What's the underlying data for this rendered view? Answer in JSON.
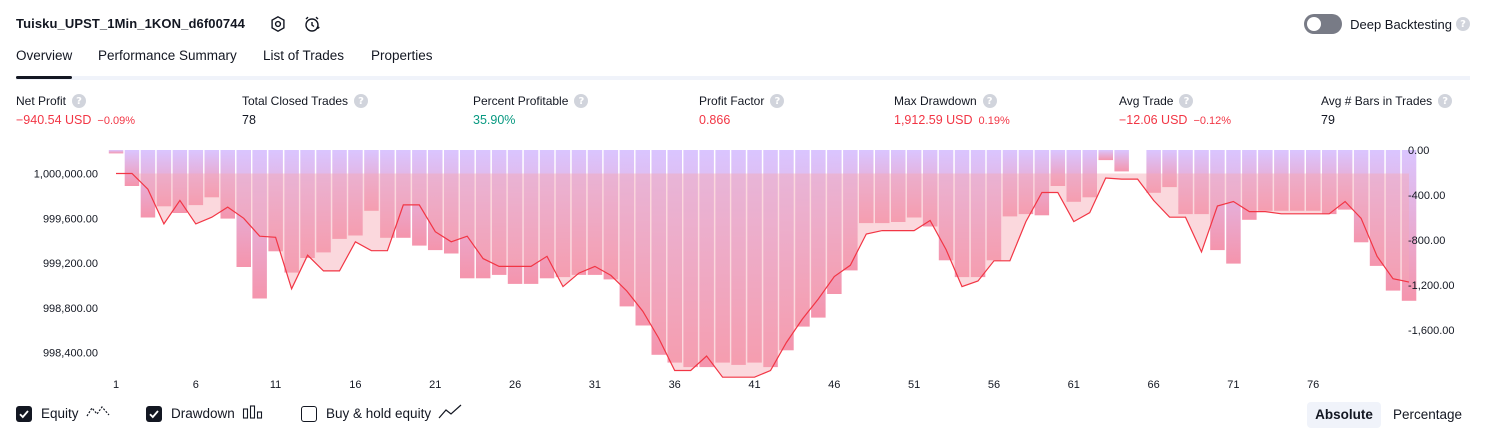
{
  "header": {
    "strategy_name": "Tuisku_UPST_1Min_1KON_d6f00744",
    "settings_icon": "settings-icon",
    "alert_icon": "alarm-clock-icon",
    "deep_backtesting_label": "Deep Backtesting",
    "deep_backtesting_enabled": false
  },
  "tabs": [
    {
      "label": "Overview",
      "active": true
    },
    {
      "label": "Performance Summary",
      "active": false
    },
    {
      "label": "List of Trades",
      "active": false
    },
    {
      "label": "Properties",
      "active": false
    }
  ],
  "metrics": [
    {
      "title": "Net Profit",
      "value": "−940.54 USD",
      "pct": "−0.09%",
      "color": "red"
    },
    {
      "title": "Total Closed Trades",
      "value": "78",
      "pct": "",
      "color": "dark"
    },
    {
      "title": "Percent Profitable",
      "value": "35.90%",
      "pct": "",
      "color": "green"
    },
    {
      "title": "Profit Factor",
      "value": "0.866",
      "pct": "",
      "color": "red"
    },
    {
      "title": "Max Drawdown",
      "value": "1,912.59 USD",
      "pct": "0.19%",
      "color": "red"
    },
    {
      "title": "Avg Trade",
      "value": "−12.06 USD",
      "pct": "−0.12%",
      "color": "red"
    },
    {
      "title": "Avg # Bars in Trades",
      "value": "79",
      "pct": "",
      "color": "dark"
    }
  ],
  "colors": {
    "accent": "#131722",
    "negative": "#f23645",
    "positive": "#089981",
    "drawdown_bar": "#d1b3ff",
    "equity_line": "#f23645"
  },
  "chart_data": {
    "type": "bar",
    "x_ticks": [
      "1",
      "6",
      "11",
      "16",
      "21",
      "26",
      "31",
      "36",
      "41",
      "46",
      "51",
      "56",
      "61",
      "66",
      "71",
      "76"
    ],
    "x_range": [
      1,
      79
    ],
    "left_axis": {
      "ticks": [
        "1,000,000.00",
        "999,600.00",
        "999,200.00",
        "998,800.00",
        "998,400.00"
      ],
      "range": [
        998200,
        1000210
      ]
    },
    "right_axis": {
      "ticks": [
        "0.00",
        "-400.00",
        "-800.00",
        "-1,200.00",
        "-1,600.00"
      ],
      "range": [
        -2000,
        0
      ]
    },
    "series": [
      {
        "name": "Drawdown",
        "kind": "bar",
        "values": [
          -30,
          -320,
          -600,
          -500,
          -560,
          -490,
          -420,
          -610,
          -1040,
          -1320,
          -900,
          -1090,
          -960,
          -910,
          -790,
          -760,
          -540,
          -780,
          -780,
          -850,
          -890,
          -920,
          -1140,
          -1140,
          -1110,
          -1190,
          -1190,
          -1140,
          -1130,
          -1110,
          -1110,
          -1150,
          -1390,
          -1560,
          -1820,
          -1890,
          -1930,
          -1930,
          -1890,
          -1910,
          -1890,
          -1930,
          -1780,
          -1570,
          -1490,
          -1280,
          -1070,
          -650,
          -650,
          -640,
          -600,
          -680,
          -980,
          -1130,
          -1130,
          -980,
          -590,
          -570,
          -580,
          -320,
          -460,
          -420,
          -90,
          -190,
          0,
          -380,
          -330,
          -570,
          -570,
          -890,
          -1010,
          -620,
          -540,
          -540,
          -540,
          -540,
          -570,
          -530,
          -820,
          -1030,
          -1250,
          -1340
        ]
      },
      {
        "name": "Equity",
        "kind": "line",
        "values": [
          1000000,
          1000000,
          999860,
          999550,
          999760,
          999550,
          999610,
          999700,
          999600,
          999440,
          999430,
          998970,
          999270,
          999130,
          999130,
          999390,
          999310,
          999310,
          999720,
          999720,
          999480,
          999390,
          999440,
          999240,
          999170,
          999170,
          999170,
          999260,
          998990,
          999110,
          999170,
          999090,
          998950,
          998770,
          998530,
          998240,
          998240,
          998370,
          998180,
          998180,
          998180,
          998240,
          998490,
          998700,
          998880,
          999080,
          999180,
          999460,
          999490,
          999490,
          999490,
          999580,
          999320,
          998990,
          999040,
          999220,
          999220,
          999570,
          999830,
          999830,
          999570,
          999650,
          999960,
          999950,
          999950,
          999760,
          999610,
          999610,
          999300,
          999710,
          999750,
          999660,
          999660,
          999640,
          999640,
          999640,
          999640,
          999750,
          999600,
          999260,
          999060,
          999030
        ]
      }
    ]
  },
  "legend": [
    {
      "label": "Equity",
      "checked": true,
      "icon": "equity-line-icon"
    },
    {
      "label": "Drawdown",
      "checked": true,
      "icon": "drawdown-bars-icon"
    },
    {
      "label": "Buy & hold equity",
      "checked": false,
      "icon": "buy-hold-line-icon"
    }
  ],
  "view_mode": {
    "options": [
      "Absolute",
      "Percentage"
    ],
    "selected": "Absolute"
  }
}
